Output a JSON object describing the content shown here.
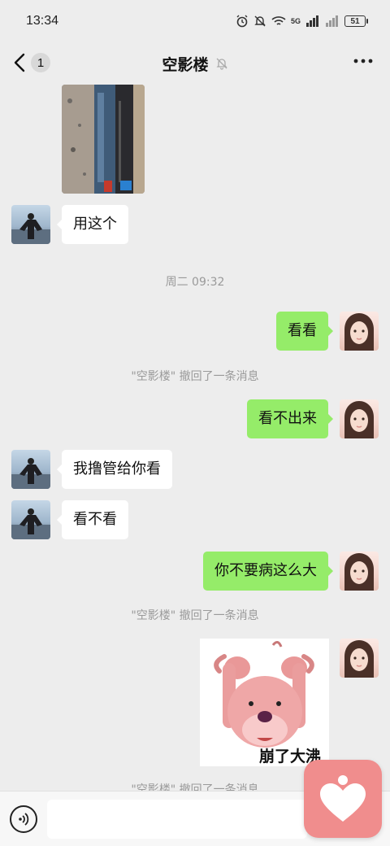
{
  "status_bar": {
    "time": "13:34",
    "battery": "51",
    "network": "5G"
  },
  "header": {
    "back_count": "1",
    "title": "空影楼",
    "mute_icon": "bell-off-icon",
    "more_icon": "more-dots-icon"
  },
  "messages": {
    "m1": "用这个",
    "timestamp": "周二 09:32",
    "m2": "看看",
    "recall1": "\"空影楼\" 撤回了一条消息",
    "m3": "看不出来",
    "m4": "我撸管给你看",
    "m5": "看不看",
    "m6": "你不要病这么大",
    "recall2": "\"空影楼\" 撤回了一条消息",
    "sticker_caption": "崩了大沸",
    "recall3": "\"空影楼\" 撤回了一条消息"
  },
  "input_bar": {
    "voice_icon": "voice-icon",
    "placeholder": ""
  },
  "floating_button": {
    "icon": "heart-person-icon",
    "color": "#f08d8d"
  },
  "colors": {
    "outgoing_bubble": "#95ec69",
    "incoming_bubble": "#ffffff",
    "background": "#ededed"
  }
}
